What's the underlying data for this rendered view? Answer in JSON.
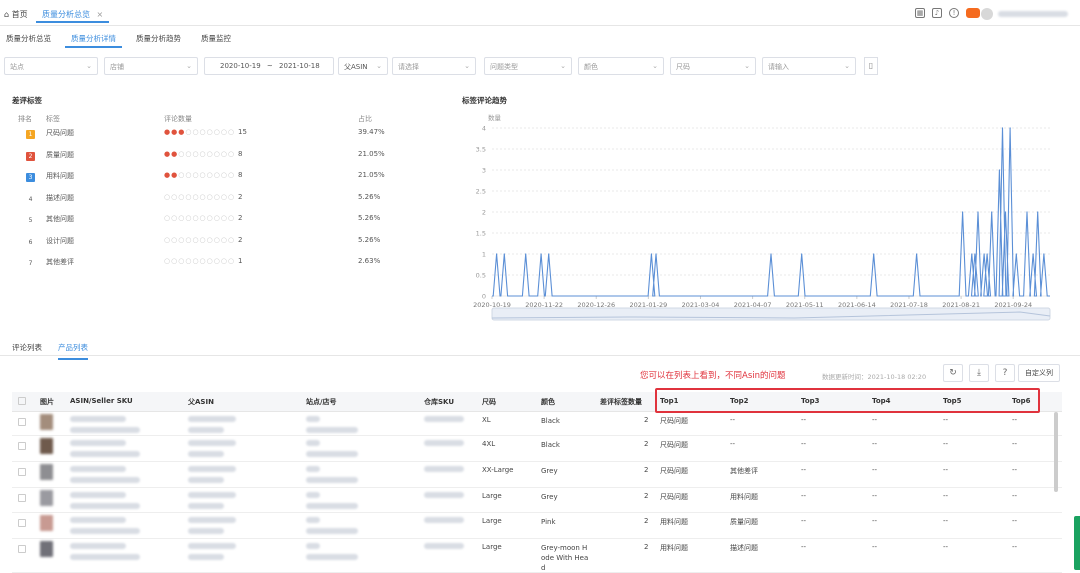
{
  "topbar": {
    "home_label": "首页",
    "active_tab": "质量分析总览",
    "close_glyph": "×"
  },
  "subtabs": [
    "质量分析总览",
    "质量分析详情",
    "质量分析趋势",
    "质量监控"
  ],
  "subtab_active_index": 1,
  "filters": {
    "f1": "站点",
    "f2": "店铺",
    "date_start": "2020-10-19",
    "date_sep": "~",
    "date_end": "2021-10-18",
    "asin_label": "父ASIN",
    "f5": "请选择",
    "f6": "问题类型",
    "f7": "颜色",
    "f8": "尺码",
    "f9": "请输入"
  },
  "tags_section": {
    "title": "差评标签",
    "columns": [
      "排名",
      "标签",
      "评论数量",
      "占比"
    ],
    "rows": [
      {
        "rank": "1",
        "label": "尺码问题",
        "drops_on": 3,
        "count": "15",
        "pct": "39.47%",
        "color": "#f5a623"
      },
      {
        "rank": "2",
        "label": "质量问题",
        "drops_on": 2,
        "count": "8",
        "pct": "21.05%",
        "color": "#e0533d"
      },
      {
        "rank": "3",
        "label": "用料问题",
        "drops_on": 2,
        "count": "8",
        "pct": "21.05%",
        "color": "#3c8dde"
      },
      {
        "rank": "4",
        "label": "描述问题",
        "drops_on": 0,
        "count": "2",
        "pct": "5.26%",
        "color": ""
      },
      {
        "rank": "5",
        "label": "其他问题",
        "drops_on": 0,
        "count": "2",
        "pct": "5.26%",
        "color": ""
      },
      {
        "rank": "6",
        "label": "设计问题",
        "drops_on": 0,
        "count": "2",
        "pct": "5.26%",
        "color": ""
      },
      {
        "rank": "7",
        "label": "其他差评",
        "drops_on": 0,
        "count": "1",
        "pct": "2.63%",
        "color": ""
      }
    ]
  },
  "chart_data": {
    "type": "line",
    "title": "标签评论趋势",
    "ylabel": "数量",
    "ylim": [
      0,
      4
    ],
    "y_ticks": [
      "0",
      "0.5",
      "1",
      "1.5",
      "2",
      "2.5",
      "3",
      "3.5",
      "4"
    ],
    "x_ticks": [
      "2020-10-19",
      "2020-11-22",
      "2020-12-26",
      "2021-01-29",
      "2021-03-04",
      "2021-04-07",
      "2021-05-11",
      "2021-06-14",
      "2021-07-18",
      "2021-08-21",
      "2021-09-24"
    ],
    "x_range": [
      "2020-10-19",
      "2021-10-18"
    ],
    "series": [
      {
        "color": "#5b8fd6",
        "spikes": [
          {
            "x": "2020-10-22",
            "y": 1
          },
          {
            "x": "2020-10-27",
            "y": 1
          },
          {
            "x": "2020-11-10",
            "y": 1
          },
          {
            "x": "2020-11-20",
            "y": 1
          },
          {
            "x": "2020-11-25",
            "y": 1
          },
          {
            "x": "2021-01-31",
            "y": 1
          },
          {
            "x": "2021-02-03",
            "y": 1
          },
          {
            "x": "2021-04-19",
            "y": 1
          },
          {
            "x": "2021-05-09",
            "y": 1
          },
          {
            "x": "2021-06-25",
            "y": 1
          },
          {
            "x": "2021-07-23",
            "y": 1
          },
          {
            "x": "2021-08-22",
            "y": 2
          },
          {
            "x": "2021-08-28",
            "y": 1
          },
          {
            "x": "2021-08-30",
            "y": 1
          },
          {
            "x": "2021-09-01",
            "y": 2
          },
          {
            "x": "2021-09-05",
            "y": 1
          },
          {
            "x": "2021-09-07",
            "y": 1
          },
          {
            "x": "2021-09-10",
            "y": 2
          },
          {
            "x": "2021-09-15",
            "y": 3
          },
          {
            "x": "2021-09-17",
            "y": 4
          },
          {
            "x": "2021-09-19",
            "y": 2
          },
          {
            "x": "2021-09-22",
            "y": 4
          },
          {
            "x": "2021-09-26",
            "y": 1
          },
          {
            "x": "2021-10-03",
            "y": 2
          },
          {
            "x": "2021-10-07",
            "y": 1
          },
          {
            "x": "2021-10-10",
            "y": 2
          },
          {
            "x": "2021-10-14",
            "y": 1
          }
        ]
      }
    ]
  },
  "list_tabs": [
    "评论列表",
    "产品列表"
  ],
  "list_tab_active_index": 1,
  "note": "您可以在列表上看到，不同Asin的问题",
  "updated_label": "数据更新时间：2021-10-18 02:20",
  "column_settings": "自定义列",
  "icons": {
    "refresh": "↻",
    "download": "⤓",
    "help": "?",
    "calendar": "▦",
    "bell": "♪",
    "info": "!",
    "trash": "🗑"
  },
  "table": {
    "headers": [
      "图片",
      "ASIN/Seller SKU",
      "父ASIN",
      "站点/店号",
      "仓库SKU",
      "尺码",
      "颜色",
      "差评标签数量",
      "Top1",
      "Top2",
      "Top3",
      "Top4",
      "Top5",
      "Top6"
    ],
    "rows": [
      {
        "size": "XL",
        "color": "Black",
        "count": "2",
        "top1": "尺码问题",
        "top2": "--",
        "top3": "--",
        "top4": "--",
        "top5": "--",
        "top6": "--",
        "thumb": "#a38d7c"
      },
      {
        "size": "4XL",
        "color": "Black",
        "count": "2",
        "top1": "尺码问题",
        "top2": "--",
        "top3": "--",
        "top4": "--",
        "top5": "--",
        "top6": "--",
        "thumb": "#6f5a4c"
      },
      {
        "size": "XX-Large",
        "color": "Grey",
        "count": "2",
        "top1": "尺码问题",
        "top2": "其他差评",
        "top3": "--",
        "top4": "--",
        "top5": "--",
        "top6": "--",
        "thumb": "#8e8e92"
      },
      {
        "size": "Large",
        "color": "Grey",
        "count": "2",
        "top1": "尺码问题",
        "top2": "用料问题",
        "top3": "--",
        "top4": "--",
        "top5": "--",
        "top6": "--",
        "thumb": "#9a9aa0"
      },
      {
        "size": "Large",
        "color": "Pink",
        "count": "2",
        "top1": "用料问题",
        "top2": "质量问题",
        "top3": "--",
        "top4": "--",
        "top5": "--",
        "top6": "--",
        "thumb": "#c89a92"
      },
      {
        "size": "Large",
        "color": "Grey-moon H ode With Hea d",
        "count": "2",
        "top1": "用料问题",
        "top2": "描述问题",
        "top3": "--",
        "top4": "--",
        "top5": "--",
        "top6": "--",
        "thumb": "#707078"
      }
    ]
  }
}
